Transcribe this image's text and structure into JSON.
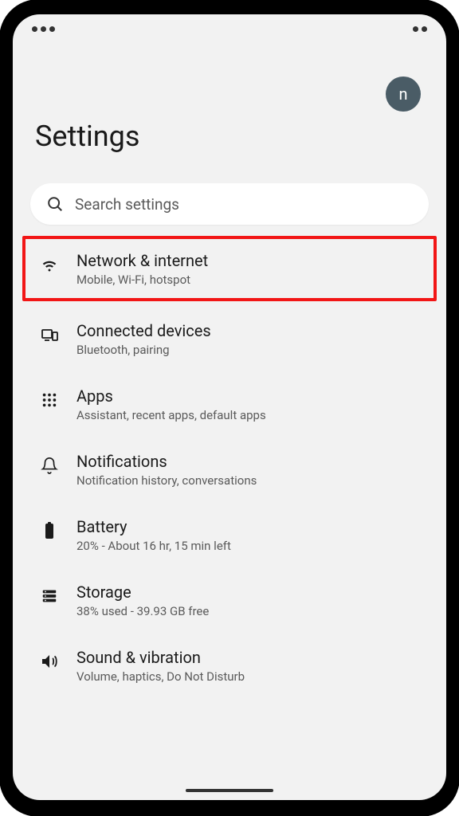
{
  "header": {
    "title": "Settings",
    "avatar_letter": "n"
  },
  "search": {
    "placeholder": "Search settings"
  },
  "items": [
    {
      "title": "Network & internet",
      "subtitle": "Mobile, Wi-Fi, hotspot",
      "highlighted": true
    },
    {
      "title": "Connected devices",
      "subtitle": "Bluetooth, pairing",
      "highlighted": false
    },
    {
      "title": "Apps",
      "subtitle": "Assistant, recent apps, default apps",
      "highlighted": false
    },
    {
      "title": "Notifications",
      "subtitle": "Notification history, conversations",
      "highlighted": false
    },
    {
      "title": "Battery",
      "subtitle": "20% - About 16 hr, 15 min left",
      "highlighted": false
    },
    {
      "title": "Storage",
      "subtitle": "38% used - 39.93 GB free",
      "highlighted": false
    },
    {
      "title": "Sound & vibration",
      "subtitle": "Volume, haptics, Do Not Disturb",
      "highlighted": false
    }
  ],
  "colors": {
    "highlight_border": "#f21616",
    "avatar_bg": "#4a5c66",
    "screen_bg": "#f2f2f2"
  }
}
